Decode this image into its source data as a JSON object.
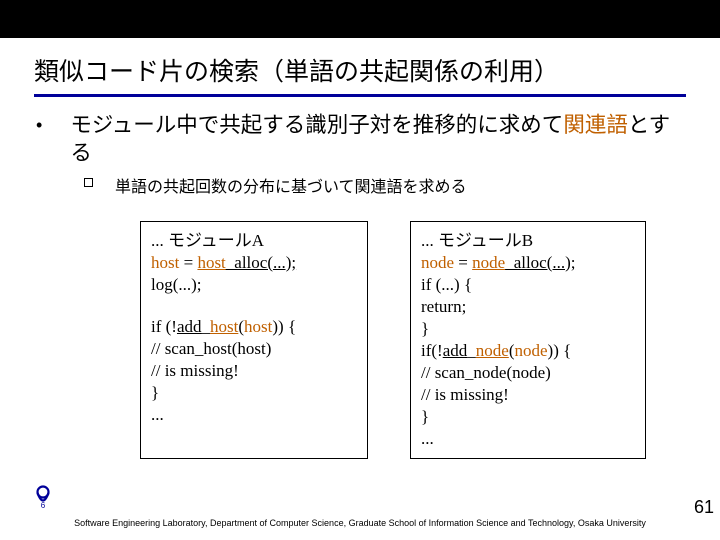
{
  "title": "類似コード片の検索（単語の共起関係の利用）",
  "bullet": {
    "pre": "モジュール中で共起する識別子対を推移的に求めて",
    "hl": "関連語",
    "post": "とする"
  },
  "sub": "単語の共起回数の分布に基づいて関連語を求める",
  "moduleA": {
    "l1a": "...   モジュールA",
    "l2a": "host",
    "l2b": " = ",
    "l2c": "host",
    "l2d": "_alloc(...);",
    "l3": "log(...);",
    "l4a": "if (!",
    "l4b": "add",
    "l4c": "_",
    "l4d": "host",
    "l4e": "(",
    "l4f": "host",
    "l4g": ")) {",
    "l5": "// scan_host(host)",
    "l6": "// is missing!",
    "l7": "}",
    "l8": "..."
  },
  "moduleB": {
    "l1a": "...   モジュールB",
    "l2a": "node",
    "l2b": " = ",
    "l2c": "node",
    "l2d": "_alloc(...);",
    "l3": "if (...) {",
    "l4": "    return;",
    "l5": "}",
    "l6a": "if(!",
    "l6b": "add",
    "l6c": "_",
    "l6d": "node",
    "l6e": "(",
    "l6f": "node",
    "l6g": ")) {",
    "l7": "// scan_node(node)",
    "l8": "// is missing!",
    "l9": "}",
    "l10": "..."
  },
  "logo_badge": "6",
  "footer": "Software Engineering Laboratory, Department of Computer Science, Graduate School of Information Science and Technology, Osaka University",
  "pagenum": "61"
}
